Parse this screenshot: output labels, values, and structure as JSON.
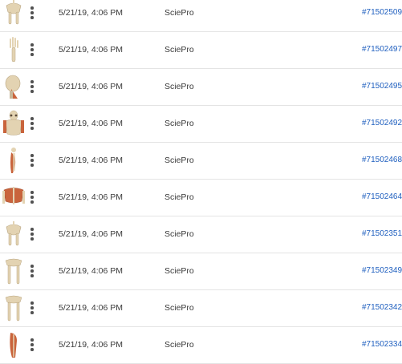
{
  "colors": {
    "link": "#1f5fbf",
    "text": "#3a3a3a",
    "divider": "#e4e4e4",
    "bone": "#e3d3b2",
    "muscle": "#c9643c"
  },
  "rows": [
    {
      "thumbnail_icon": "pelvis-skeleton-icon",
      "date": "5/21/19, 4:06 PM",
      "source": "SciePro",
      "id": "#71502509"
    },
    {
      "thumbnail_icon": "hand-bones-icon",
      "date": "5/21/19, 4:06 PM",
      "source": "SciePro",
      "id": "#71502497"
    },
    {
      "thumbnail_icon": "skull-muscles-icon",
      "date": "5/21/19, 4:06 PM",
      "source": "SciePro",
      "id": "#71502495"
    },
    {
      "thumbnail_icon": "thorax-skeleton-icon",
      "date": "5/21/19, 4:06 PM",
      "source": "SciePro",
      "id": "#71502492"
    },
    {
      "thumbnail_icon": "arm-muscles-icon",
      "date": "5/21/19, 4:06 PM",
      "source": "SciePro",
      "id": "#71502468"
    },
    {
      "thumbnail_icon": "back-muscles-icon",
      "date": "5/21/19, 4:06 PM",
      "source": "SciePro",
      "id": "#71502464"
    },
    {
      "thumbnail_icon": "pelvis-skeleton-icon",
      "date": "5/21/19, 4:06 PM",
      "source": "SciePro",
      "id": "#71502351"
    },
    {
      "thumbnail_icon": "legs-skeleton-icon",
      "date": "5/21/19, 4:06 PM",
      "source": "SciePro",
      "id": "#71502349"
    },
    {
      "thumbnail_icon": "legs-skeleton-icon",
      "date": "5/21/19, 4:06 PM",
      "source": "SciePro",
      "id": "#71502342"
    },
    {
      "thumbnail_icon": "leg-muscles-icon",
      "date": "5/21/19, 4:06 PM",
      "source": "SciePro",
      "id": "#71502334"
    }
  ]
}
